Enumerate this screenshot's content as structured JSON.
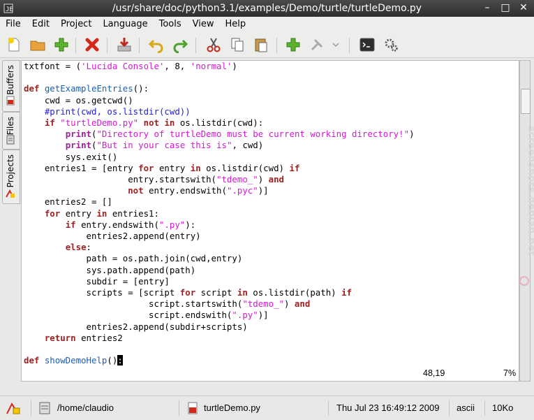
{
  "window": {
    "title": "/usr/share/doc/python3.1/examples/Demo/turtle/turtleDemo.py"
  },
  "menu": [
    "File",
    "Edit",
    "Project",
    "Language",
    "Tools",
    "View",
    "Help"
  ],
  "sidebar": {
    "tabs": [
      "Buffers",
      "Files",
      "Projects"
    ]
  },
  "editor": {
    "position": "48,19",
    "percent": "7%",
    "lines": [
      [
        [
          "t",
          "txtfont = ("
        ],
        [
          "s",
          "'Lucida Console'"
        ],
        [
          "t",
          ", 8, "
        ],
        [
          "s",
          "'normal'"
        ],
        [
          "t",
          ")"
        ]
      ],
      [],
      [
        [
          "k",
          "def "
        ],
        [
          "f",
          "getExampleEntries"
        ],
        [
          "t",
          "():"
        ]
      ],
      [
        [
          "t",
          "    cwd = os.getcwd()"
        ]
      ],
      [
        [
          "t",
          "    "
        ],
        [
          "c",
          "#print(cwd, os.listdir(cwd))"
        ]
      ],
      [
        [
          "t",
          "    "
        ],
        [
          "k",
          "if "
        ],
        [
          "s",
          "\"turtleDemo.py\""
        ],
        [
          "t",
          " "
        ],
        [
          "k",
          "not in"
        ],
        [
          "t",
          " os.listdir(cwd):"
        ]
      ],
      [
        [
          "t",
          "        "
        ],
        [
          "b",
          "print"
        ],
        [
          "t",
          "("
        ],
        [
          "s",
          "\"Directory of turtleDemo must be current working directory!\""
        ],
        [
          "t",
          ")"
        ]
      ],
      [
        [
          "t",
          "        "
        ],
        [
          "b",
          "print"
        ],
        [
          "t",
          "("
        ],
        [
          "s",
          "\"But in your case this is\""
        ],
        [
          "t",
          ", cwd)"
        ]
      ],
      [
        [
          "t",
          "        sys.exit()"
        ]
      ],
      [
        [
          "t",
          "    entries1 = [entry "
        ],
        [
          "k",
          "for"
        ],
        [
          "t",
          " entry "
        ],
        [
          "k",
          "in"
        ],
        [
          "t",
          " os.listdir(cwd) "
        ],
        [
          "k",
          "if"
        ]
      ],
      [
        [
          "t",
          "                    entry.startswith("
        ],
        [
          "s",
          "\"tdemo_\""
        ],
        [
          "t",
          ") "
        ],
        [
          "k",
          "and"
        ]
      ],
      [
        [
          "t",
          "                    "
        ],
        [
          "k",
          "not"
        ],
        [
          "t",
          " entry.endswith("
        ],
        [
          "s",
          "\".pyc\""
        ],
        [
          "t",
          ")]"
        ]
      ],
      [
        [
          "t",
          "    entries2 = []"
        ]
      ],
      [
        [
          "t",
          "    "
        ],
        [
          "k",
          "for"
        ],
        [
          "t",
          " entry "
        ],
        [
          "k",
          "in"
        ],
        [
          "t",
          " entries1:"
        ]
      ],
      [
        [
          "t",
          "        "
        ],
        [
          "k",
          "if"
        ],
        [
          "t",
          " entry.endswith("
        ],
        [
          "s",
          "\".py\""
        ],
        [
          "t",
          "):"
        ]
      ],
      [
        [
          "t",
          "            entries2.append(entry)"
        ]
      ],
      [
        [
          "t",
          "        "
        ],
        [
          "k",
          "else"
        ],
        [
          "t",
          ":"
        ]
      ],
      [
        [
          "t",
          "            path = os.path.join(cwd,entry)"
        ]
      ],
      [
        [
          "t",
          "            sys.path.append(path)"
        ]
      ],
      [
        [
          "t",
          "            subdir = [entry]"
        ]
      ],
      [
        [
          "t",
          "            scripts = [script "
        ],
        [
          "k",
          "for"
        ],
        [
          "t",
          " script "
        ],
        [
          "k",
          "in"
        ],
        [
          "t",
          " os.listdir(path) "
        ],
        [
          "k",
          "if"
        ]
      ],
      [
        [
          "t",
          "                        script.startswith("
        ],
        [
          "s",
          "\"tdemo_\""
        ],
        [
          "t",
          ") "
        ],
        [
          "k",
          "and"
        ]
      ],
      [
        [
          "t",
          "                        script.endswith("
        ],
        [
          "s",
          "\".py\""
        ],
        [
          "t",
          ")]"
        ]
      ],
      [
        [
          "t",
          "            entries2.append(subdir+scripts)"
        ]
      ],
      [
        [
          "t",
          "    "
        ],
        [
          "k",
          "return"
        ],
        [
          "t",
          " entries2"
        ]
      ],
      [],
      [
        [
          "k",
          "def "
        ],
        [
          "f",
          "showDemoHelp"
        ],
        [
          "t",
          "()"
        ],
        [
          "x",
          ":"
        ]
      ]
    ]
  },
  "watermark": "screenshots.debian.net",
  "status": {
    "dir": "/home/claudio",
    "file": "turtleDemo.py",
    "date": "Thu Jul 23 16:49:12 2009",
    "encoding": "ascii",
    "size": "10Ko"
  },
  "colors": {
    "keyword": "#a0201f",
    "builtin": "#a020a0",
    "function": "#1a5fb4",
    "string": "#d419d4",
    "comment": "#2020e0"
  }
}
